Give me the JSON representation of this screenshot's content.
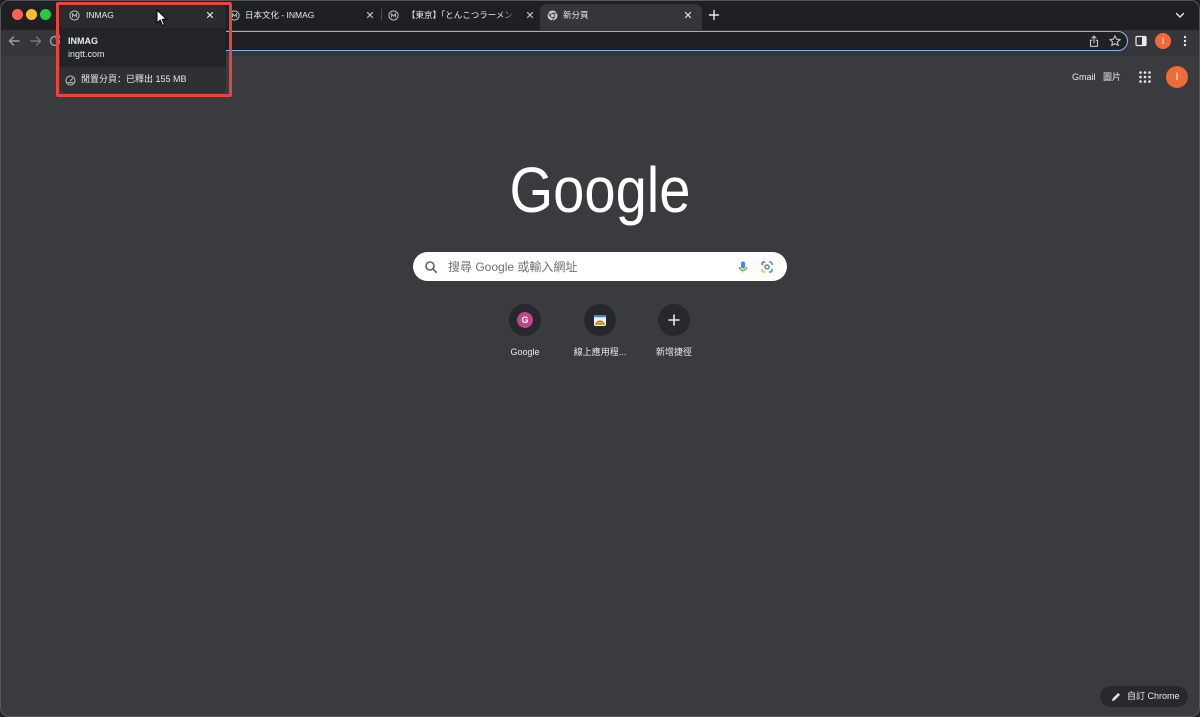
{
  "window": {
    "controls": [
      "#ff5f57",
      "#febc2e",
      "#28c840"
    ]
  },
  "tabs": [
    {
      "title": "INMAG",
      "favicon": "inmag-favicon",
      "hovered": true
    },
    {
      "title": "日本文化 - INMAG",
      "favicon": "inmag-favicon"
    },
    {
      "title": "【東京】「とんこつラーメン",
      "favicon": "inmag-favicon"
    },
    {
      "title": "新分頁",
      "favicon": "chrome-favicon",
      "active": true
    }
  ],
  "tab_strip": {
    "new_tab_icon": "plus-icon",
    "tab_search_icon": "chevron-down-icon"
  },
  "hover_card": {
    "title": "INMAG",
    "domain": "ingtt.com",
    "memory_icon": "memory-saver-icon",
    "memory_text": "閒置分頁：已釋出 155 MB"
  },
  "toolbar": {
    "omnibox_value": "",
    "avatar_letter": "I",
    "icons": [
      "back-icon",
      "forward-icon",
      "reload-icon",
      "share-icon",
      "bookmark-star-icon",
      "side-panel-icon",
      "more-menu-icon"
    ]
  },
  "ntp": {
    "gmail_link": "Gmail",
    "images_link": "圖片",
    "apps_icon": "apps-grid-icon",
    "avatar_letter": "I",
    "logo_text": "Google",
    "search": {
      "placeholder": "搜尋 Google 或輸入網址",
      "icons": [
        "search-icon",
        "voice-search-icon",
        "lens-icon"
      ]
    },
    "shortcuts": [
      {
        "label": "Google",
        "icon": "google-favicon",
        "icon_letter": "G"
      },
      {
        "label": "線上應用程...",
        "icon": "web-store-icon"
      },
      {
        "label": "新增捷徑",
        "icon": "plus-icon"
      }
    ],
    "customize_button": {
      "label": "自訂 Chrome",
      "icon": "pencil-icon"
    }
  },
  "colors": {
    "frame": "#1f2023",
    "tab_hover": "#2a2b2e",
    "toolbar": "#35363a",
    "ntp_background": "#3a3b3f",
    "omnibox_focus_ring": "#8ab4f8",
    "avatar": "#f06b38",
    "google_shortcut": "#c0468a",
    "highlight_box": "#e8453c",
    "text": "#e8eaed"
  }
}
